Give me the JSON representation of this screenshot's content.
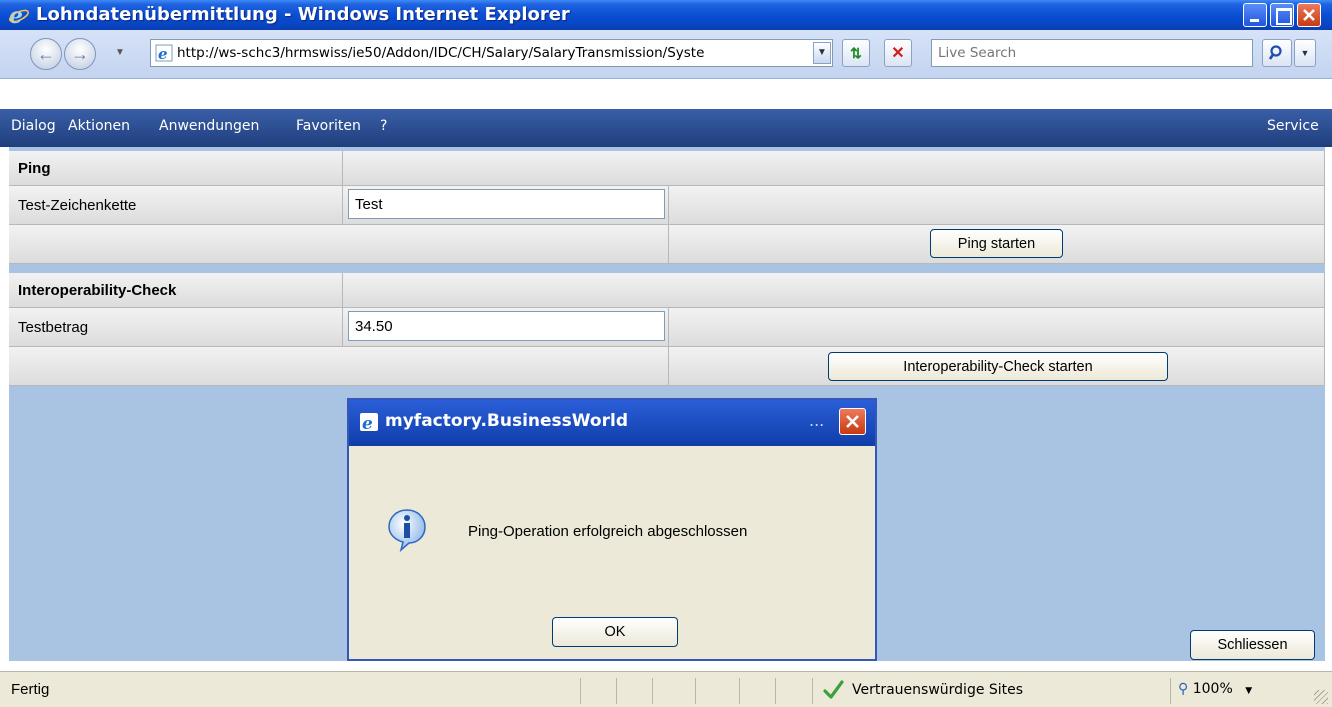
{
  "window": {
    "title": "Lohndatenübermittlung - Windows Internet Explorer"
  },
  "address_bar": {
    "url": "http://ws-schc3/hrmswiss/ie50/Addon/IDC/CH/Salary/SalaryTransmission/Syste",
    "search_placeholder": "Live Search"
  },
  "menu": {
    "items": [
      "Dialog",
      "Aktionen",
      "Anwendungen",
      "Favoriten",
      "?"
    ],
    "service": "Service"
  },
  "ping_section": {
    "title": "Ping",
    "field_label": "Test-Zeichenkette",
    "field_value": "Test",
    "button": "Ping starten"
  },
  "interop_section": {
    "title": "Interoperability-Check",
    "field_label": "Testbetrag",
    "field_value": "34.50",
    "button": "Interoperability-Check starten"
  },
  "close_button": "Schliessen",
  "dialog": {
    "title": "myfactory.BusinessWorld",
    "ellipsis": "...",
    "message": "Ping-Operation erfolgreich abgeschlossen",
    "ok": "OK"
  },
  "status": {
    "text": "Fertig",
    "zone": "Vertrauenswürdige Sites",
    "zoom": "100%"
  },
  "colors": {
    "titlebar": "#0a4fd4",
    "menubar": "#1f3e7d",
    "content_bg": "#a9c3e3",
    "dialog_title": "#1f4fc4"
  }
}
